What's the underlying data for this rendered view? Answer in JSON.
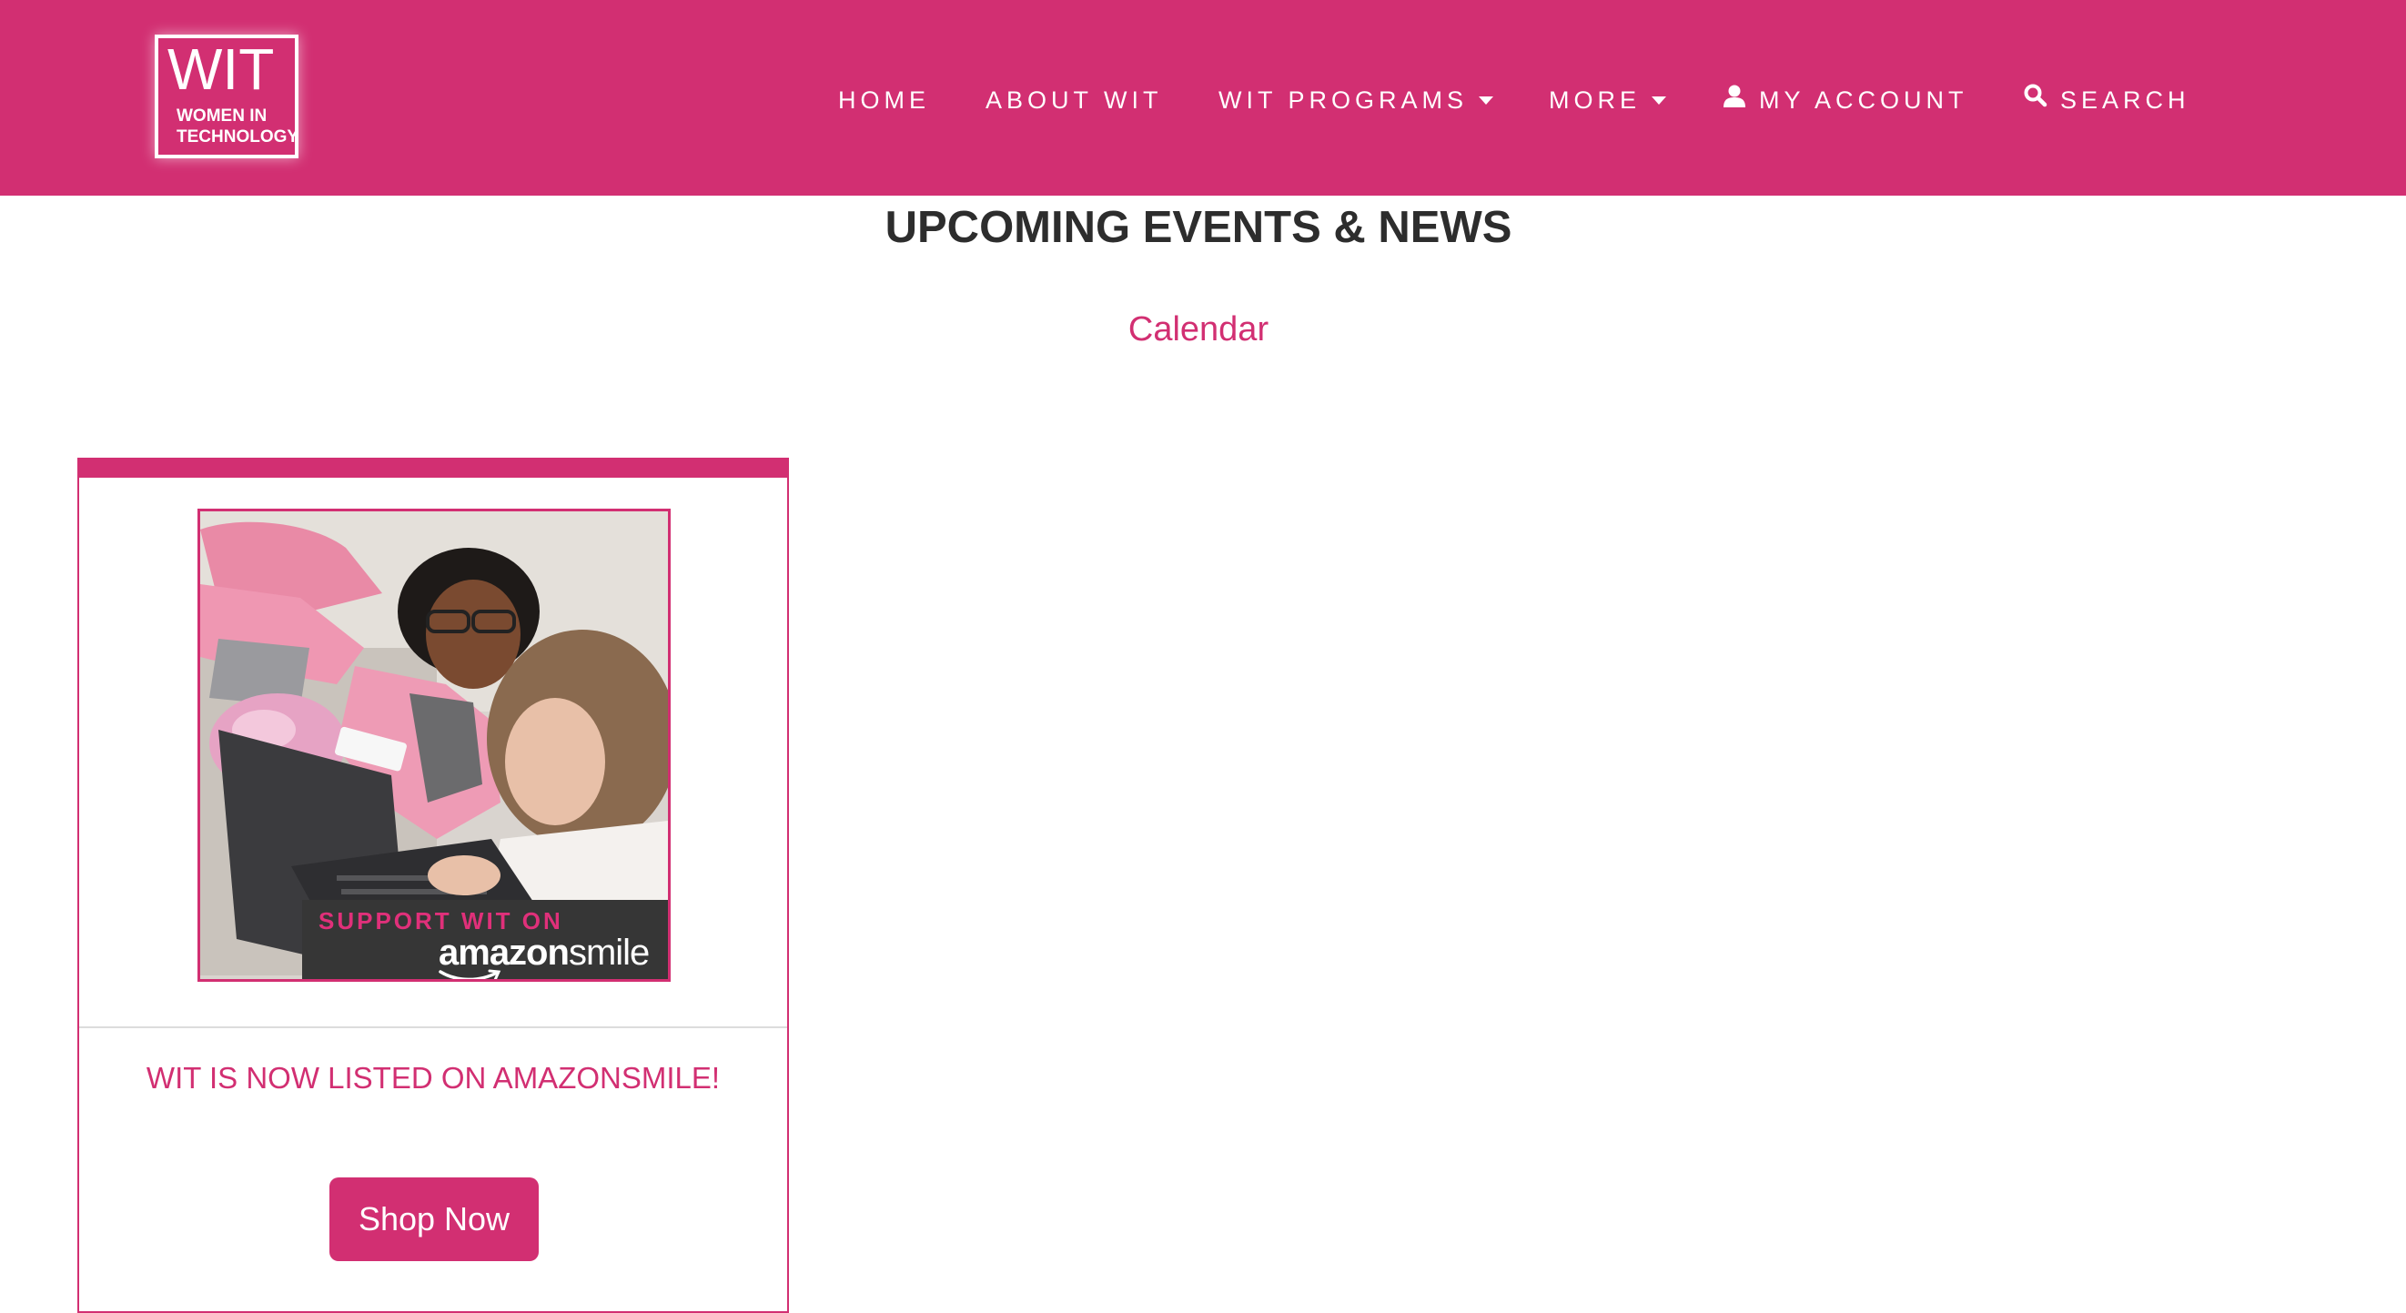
{
  "logo": {
    "big": "WIT",
    "line1": "WOMEN IN",
    "line2": "TECHNOLOGY"
  },
  "nav": {
    "items": [
      {
        "label": "HOME"
      },
      {
        "label": "ABOUT WIT"
      },
      {
        "label": "WIT PROGRAMS",
        "has_dropdown": true
      },
      {
        "label": "MORE",
        "has_dropdown": true
      },
      {
        "label": "MY ACCOUNT",
        "icon": "user-icon"
      },
      {
        "label": "SEARCH",
        "icon": "search-icon"
      }
    ]
  },
  "main": {
    "title": "UPCOMING EVENTS & NEWS",
    "calendar_link": "Calendar"
  },
  "card": {
    "promo_line1": "SUPPORT WIT ON",
    "promo_brand_bold": "amazon",
    "promo_brand_light": "smile",
    "heading": "WIT IS NOW LISTED ON AMAZONSMILE!",
    "button_label": "Shop Now"
  },
  "colors": {
    "brand": "#d22f72",
    "title_text": "#2d2d2d"
  }
}
